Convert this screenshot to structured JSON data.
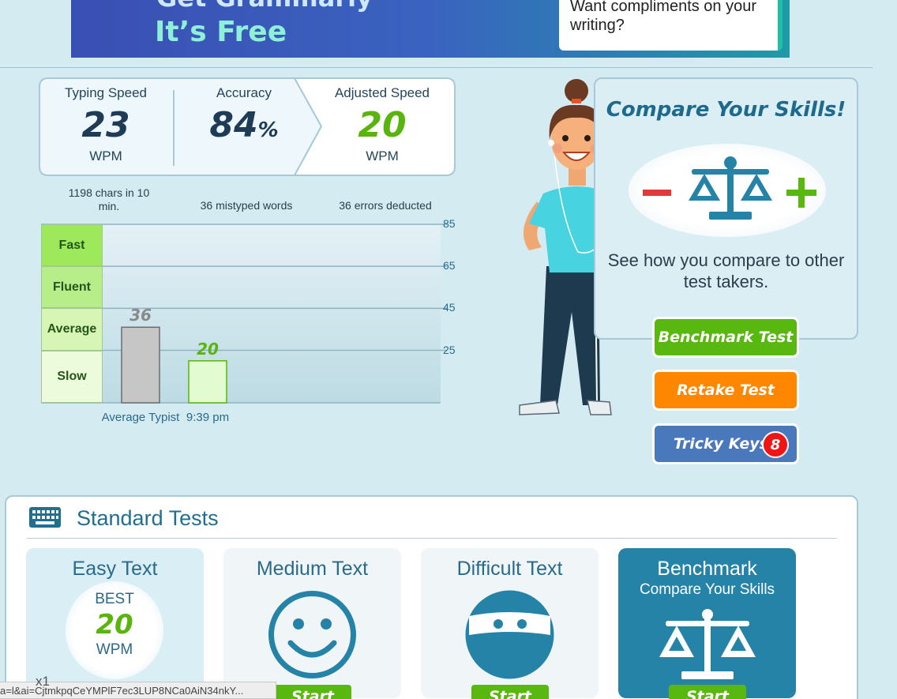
{
  "banner": {
    "headline": "Get Grammarly",
    "subline": "It’s Free",
    "card_text": "Want compliments on your writing?"
  },
  "stats": {
    "typing_speed": {
      "label": "Typing Speed",
      "value": "23",
      "unit": "WPM",
      "note": "1198 chars in 10 min."
    },
    "accuracy": {
      "label": "Accuracy",
      "value": "84",
      "suffix": "%",
      "note": "36 mistyped words"
    },
    "adjusted_speed": {
      "label": "Adjusted Speed",
      "value": "20",
      "unit": "WPM",
      "note": "36 errors deducted"
    }
  },
  "chart_data": {
    "type": "bar",
    "categories": [
      "Average Typist",
      "9:39 pm"
    ],
    "values": [
      36,
      20
    ],
    "y_ticks": [
      25,
      45,
      65,
      85
    ],
    "ylim": [
      0,
      85
    ],
    "tiers": [
      "Fast",
      "Fluent",
      "Average",
      "Slow"
    ],
    "colors": {
      "average": "#c6c6c6",
      "user": "#e3fbd0",
      "average_label": "#8a8a8a",
      "user_label": "#5ab40e"
    }
  },
  "compare": {
    "title": "Compare Your Skills!",
    "description": "See how you compare to other test takers."
  },
  "actions": {
    "benchmark": "Benchmark Test",
    "retake": "Retake Test",
    "tricky": "Tricky Keys",
    "tricky_count": "8"
  },
  "standard_tests": {
    "title": "Standard Tests",
    "start_label": "Start",
    "easy": {
      "title": "Easy Text",
      "best_label": "BEST",
      "best_value": "20",
      "best_unit": "WPM"
    },
    "medium": {
      "title": "Medium Text"
    },
    "difficult": {
      "title": "Difficult Text"
    },
    "benchmark": {
      "title": "Benchmark",
      "subtitle": "Compare Your Skills"
    }
  },
  "status_bar": {
    "url": "a=l&ai=CjtmkpqCeYMPlF7ec3LUP8NCa0AiN34nkY...",
    "zoom": "x1"
  }
}
